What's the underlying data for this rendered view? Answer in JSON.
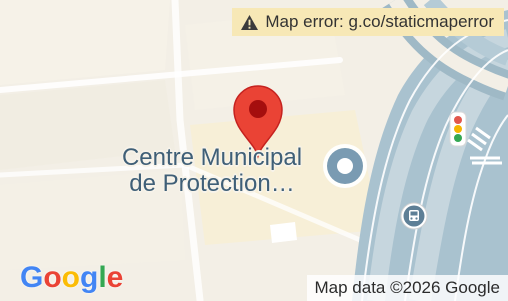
{
  "map": {
    "error_badge": {
      "icon": "warning-icon",
      "text": "Map error: g.co/staticmaperror"
    },
    "place": {
      "line1": "Centre Municipal",
      "line2": "de Protection…",
      "pin_color": "#ea4335",
      "poi_icon": "place-circle-icon"
    },
    "markers": {
      "traffic_light_icon": "traffic-light-icon",
      "bus_stop_icon": "bus-stop-icon"
    },
    "logo": {
      "letters": [
        "G",
        "o",
        "o",
        "g",
        "l",
        "e"
      ]
    },
    "attribution": "Map data ©2026 Google",
    "colors": {
      "land": "#f3efe6",
      "block": "#faf6ea",
      "road": "#ffffff",
      "water": "#aac4d2",
      "label": "#3f5f77"
    }
  }
}
